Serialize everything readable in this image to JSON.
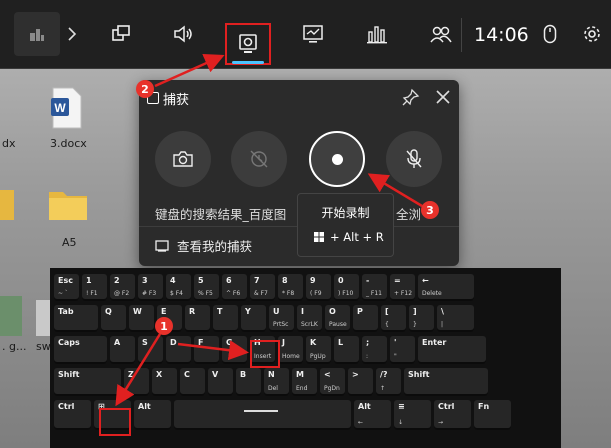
{
  "desktop": {
    "left_label_1": "dx",
    "file_label": "3.docx",
    "folder_label": "A5",
    "left_label_2": ". g...",
    "left_label_3": "sw"
  },
  "gamebar": {
    "icons": [
      "home-icon",
      "chevron-right-icon",
      "widget-icon",
      "audio-icon",
      "capture-icon",
      "performance-icon",
      "resources-icon",
      "xbox-social-icon"
    ],
    "clock": "14:06",
    "accent": "#4cc2ff"
  },
  "capture_panel": {
    "title": "捕获",
    "search_text": "键盘的搜索结果_百度图",
    "search_tail": "全浏",
    "see_captures": "查看我的捕获",
    "tooltip_title": "开始录制",
    "tooltip_shortcut": "+ Alt + R"
  },
  "badges": [
    "1",
    "2",
    "3"
  ],
  "keyboard": {
    "row1": [
      [
        "Esc",
        "~ `"
      ],
      [
        "1",
        "! F1"
      ],
      [
        "2",
        "@ F2"
      ],
      [
        "3",
        "# F3"
      ],
      [
        "4",
        "$ F4"
      ],
      [
        "5",
        "% F5"
      ],
      [
        "6",
        "^ F6"
      ],
      [
        "7",
        "& F7"
      ],
      [
        "8",
        "* F8"
      ],
      [
        "9",
        "( F9"
      ],
      [
        "0",
        ") F10"
      ],
      [
        "-",
        "_ F11"
      ],
      [
        "=",
        "+ F12"
      ],
      [
        "←",
        "Delete"
      ]
    ],
    "row2": [
      [
        "Tab",
        ""
      ],
      [
        "Q",
        ""
      ],
      [
        "W",
        ""
      ],
      [
        "E",
        "↑"
      ],
      [
        "R",
        ""
      ],
      [
        "T",
        ""
      ],
      [
        "Y",
        ""
      ],
      [
        "U",
        "PrtSc"
      ],
      [
        "I",
        "ScrLK"
      ],
      [
        "O",
        "Pause"
      ],
      [
        "P",
        ""
      ],
      [
        "[",
        "{"
      ],
      [
        "]",
        "}"
      ],
      [
        "\\",
        "|"
      ]
    ],
    "row3": [
      [
        "Caps",
        ""
      ],
      [
        "A",
        ""
      ],
      [
        "S",
        ""
      ],
      [
        "D",
        ""
      ],
      [
        "F",
        ""
      ],
      [
        "G",
        ""
      ],
      [
        "H",
        "Insert"
      ],
      [
        "J",
        "Home"
      ],
      [
        "K",
        "PgUp"
      ],
      [
        "L",
        ""
      ],
      [
        ";",
        ":"
      ],
      [
        "'",
        "\""
      ],
      [
        "Enter",
        ""
      ]
    ],
    "row4": [
      [
        "Shift",
        ""
      ],
      [
        "Z",
        ""
      ],
      [
        "X",
        ""
      ],
      [
        "C",
        ""
      ],
      [
        "V",
        ""
      ],
      [
        "B",
        ""
      ],
      [
        "N",
        "Del"
      ],
      [
        "M",
        "End"
      ],
      [
        "<",
        "PgDn"
      ],
      [
        ">",
        ""
      ],
      [
        "/?",
        "↑"
      ],
      [
        "Shift",
        ""
      ]
    ],
    "row5": [
      [
        "Ctrl",
        ""
      ],
      [
        "⊞",
        ""
      ],
      [
        "Alt",
        ""
      ],
      [
        "",
        ""
      ],
      [
        "Alt",
        "←"
      ],
      [
        "≡",
        "↓"
      ],
      [
        "Ctrl",
        "→"
      ],
      [
        "Fn",
        ""
      ]
    ]
  }
}
